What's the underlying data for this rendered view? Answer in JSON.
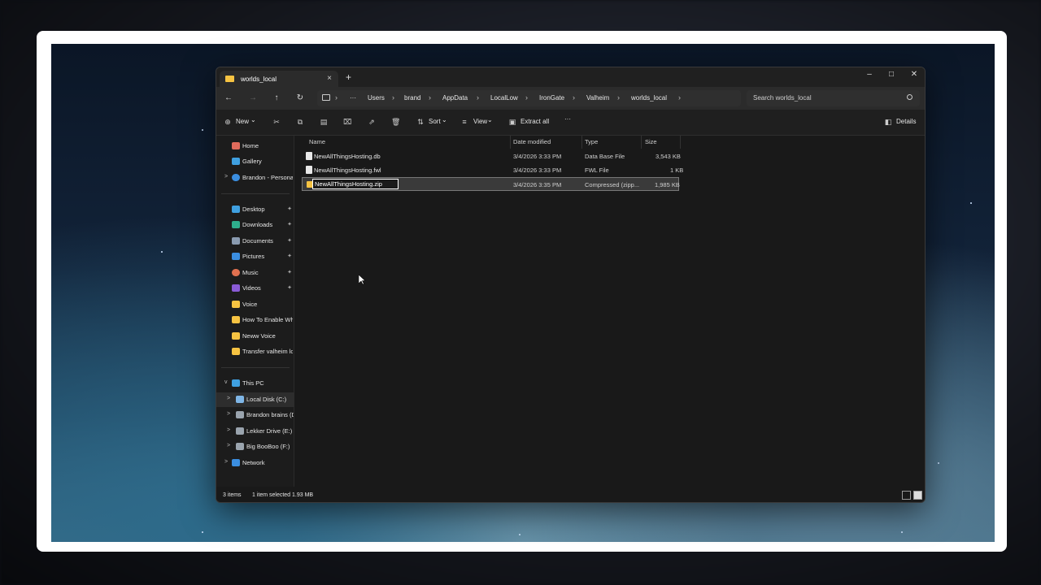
{
  "window": {
    "tab_title": "worlds_local",
    "tab_close_icon": "×",
    "new_tab_icon": "+",
    "minimize": "–",
    "maximize": "□",
    "close": "✕"
  },
  "nav": {
    "back": "←",
    "forward": "→",
    "up": "↑",
    "refresh": "↻",
    "more": "···",
    "breadcrumbs": [
      "Users",
      "brand",
      "AppData",
      "LocalLow",
      "IronGate",
      "Valheim",
      "worlds_local"
    ],
    "separator": "›",
    "search_placeholder": "Search worlds_local"
  },
  "toolbar": {
    "new_label": "New",
    "sort_label": "Sort",
    "view_label": "View",
    "extract_label": "Extract all",
    "more_label": "···",
    "details_label": "Details",
    "dropdown_caret": "⌄"
  },
  "sidebar": {
    "home": "Home",
    "gallery": "Gallery",
    "onedrive": "Brandon - Personal",
    "quick_access": [
      {
        "label": "Desktop",
        "pinned": true
      },
      {
        "label": "Downloads",
        "pinned": true
      },
      {
        "label": "Documents",
        "pinned": true
      },
      {
        "label": "Pictures",
        "pinned": true
      },
      {
        "label": "Music",
        "pinned": true
      },
      {
        "label": "Videos",
        "pinned": true
      },
      {
        "label": "Voice",
        "pinned": false
      },
      {
        "label": "How To Enable Wh",
        "pinned": false
      },
      {
        "label": "Neww Voice",
        "pinned": false
      },
      {
        "label": "Transfer valheim lo",
        "pinned": false
      }
    ],
    "this_pc": "This PC",
    "drives": [
      "Local Disk (C:)",
      "Brandon brains (D",
      "Lekker Drive (E:)",
      "Big BooBoo (F:)"
    ],
    "network": "Network",
    "pin_icon": "📌",
    "chev_right": ">",
    "chev_down": "v"
  },
  "columns": {
    "name": "Name",
    "date": "Date modified",
    "type": "Type",
    "size": "Size"
  },
  "files": [
    {
      "name": "NewAllThingsHosting.db",
      "date": "3/4/2026 3:33 PM",
      "type": "Data Base File",
      "size": "3,543 KB"
    },
    {
      "name": "NewAllThingsHosting.fwl",
      "date": "3/4/2026 3:33 PM",
      "type": "FWL File",
      "size": "1 KB"
    },
    {
      "name": "NewAllThingsHosting.zip",
      "date": "3/4/2026 3:35 PM",
      "type": "Compressed (zipp...",
      "size": "1,985 KB"
    }
  ],
  "status": {
    "count": "3 items",
    "selection": "1 item selected  1.93 MB"
  },
  "colors": {
    "accent_folder": "#f6c342",
    "window_bg": "#191919"
  }
}
